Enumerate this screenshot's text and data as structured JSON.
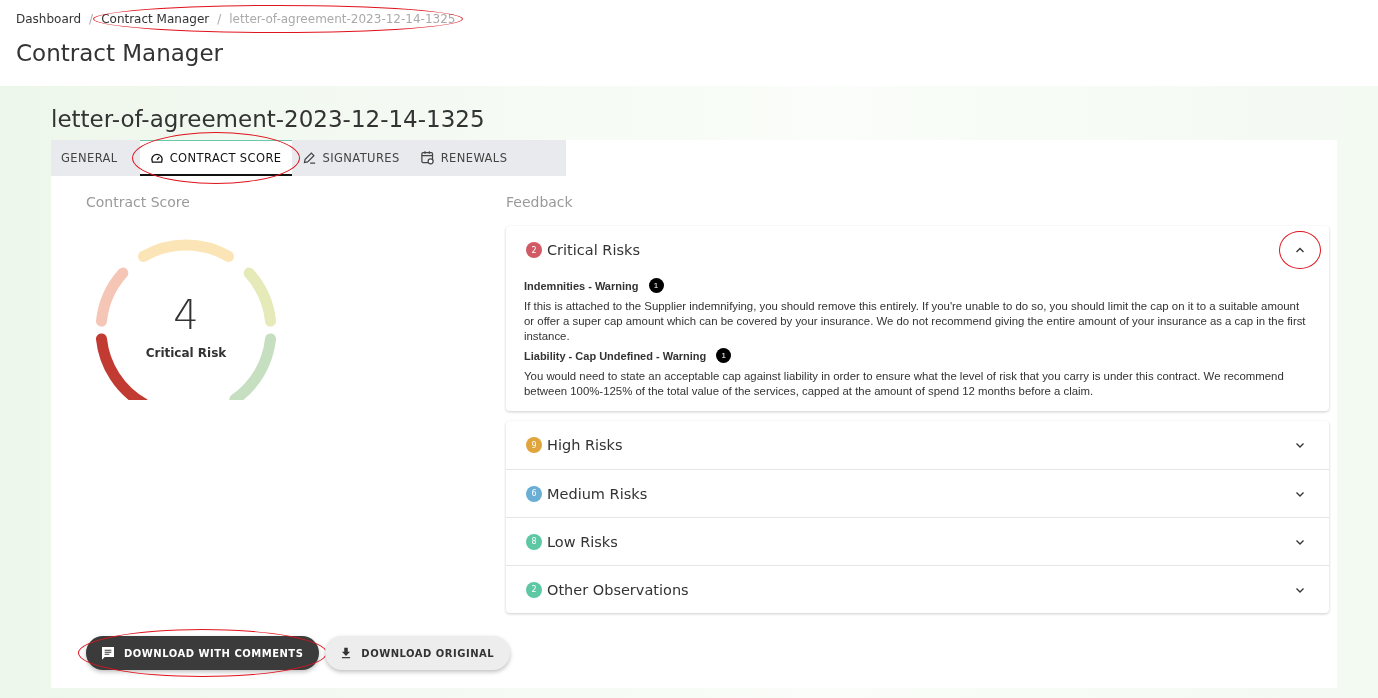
{
  "breadcrumb": {
    "separator": "/",
    "items": [
      {
        "label": "Dashboard",
        "current": false,
        "circled": false
      },
      {
        "label": "Contract Manager",
        "current": false,
        "circled": true
      },
      {
        "label": "letter-of-agreement-2023-12-14-1325",
        "current": true,
        "circled": true
      }
    ]
  },
  "page_title": "Contract Manager",
  "document_title": "letter-of-agreement-2023-12-14-1325",
  "tabs": [
    {
      "label": "GENERAL",
      "selected": false,
      "circled": false
    },
    {
      "label": "CONTRACT SCORE",
      "selected": true,
      "circled": true
    },
    {
      "label": "SIGNATURES",
      "selected": false,
      "circled": false
    },
    {
      "label": "RENEWALS",
      "selected": false,
      "circled": false
    }
  ],
  "score": {
    "heading": "Contract Score",
    "value": "4",
    "label": "Critical Risk"
  },
  "feedback": {
    "heading": "Feedback",
    "sections": [
      {
        "count": "2",
        "color": "#d05a66",
        "title": "Critical Risks",
        "expanded": true,
        "circled": true,
        "items": [
          {
            "title": "Indemnities - Warning",
            "count": "1",
            "text": "If this is attached to the Supplier indemnifying, you should remove this entirely. If you're unable to do so, you should limit the cap on it to a suitable amount or offer a super cap amount which can be covered by your insurance. We do not recommend giving the entire amount of your insurance as a cap in the first instance."
          },
          {
            "title": "Liability - Cap Undefined - Warning",
            "count": "1",
            "text": "You would need to state an acceptable cap against liability in order to ensure what the level of risk that you carry is under this contract. We recommend between 100%-125% of the total value of the services, capped at the amount of spend 12 months before a claim."
          }
        ]
      },
      {
        "count": "9",
        "color": "#e0a53c",
        "title": "High Risks",
        "expanded": false,
        "circled": false
      },
      {
        "count": "6",
        "color": "#6aaed6",
        "title": "Medium Risks",
        "expanded": false,
        "circled": false
      },
      {
        "count": "8",
        "color": "#5ec7a3",
        "title": "Low Risks",
        "expanded": false,
        "circled": false
      },
      {
        "count": "2",
        "color": "#5ec7a3",
        "title": "Other Observations",
        "expanded": false,
        "circled": false
      }
    ]
  },
  "buttons": [
    {
      "label": "DOWNLOAD WITH COMMENTS",
      "kind": "primary",
      "circled": true
    },
    {
      "label": "DOWNLOAD ORIGINAL",
      "kind": "secondary",
      "circled": false
    }
  ]
}
